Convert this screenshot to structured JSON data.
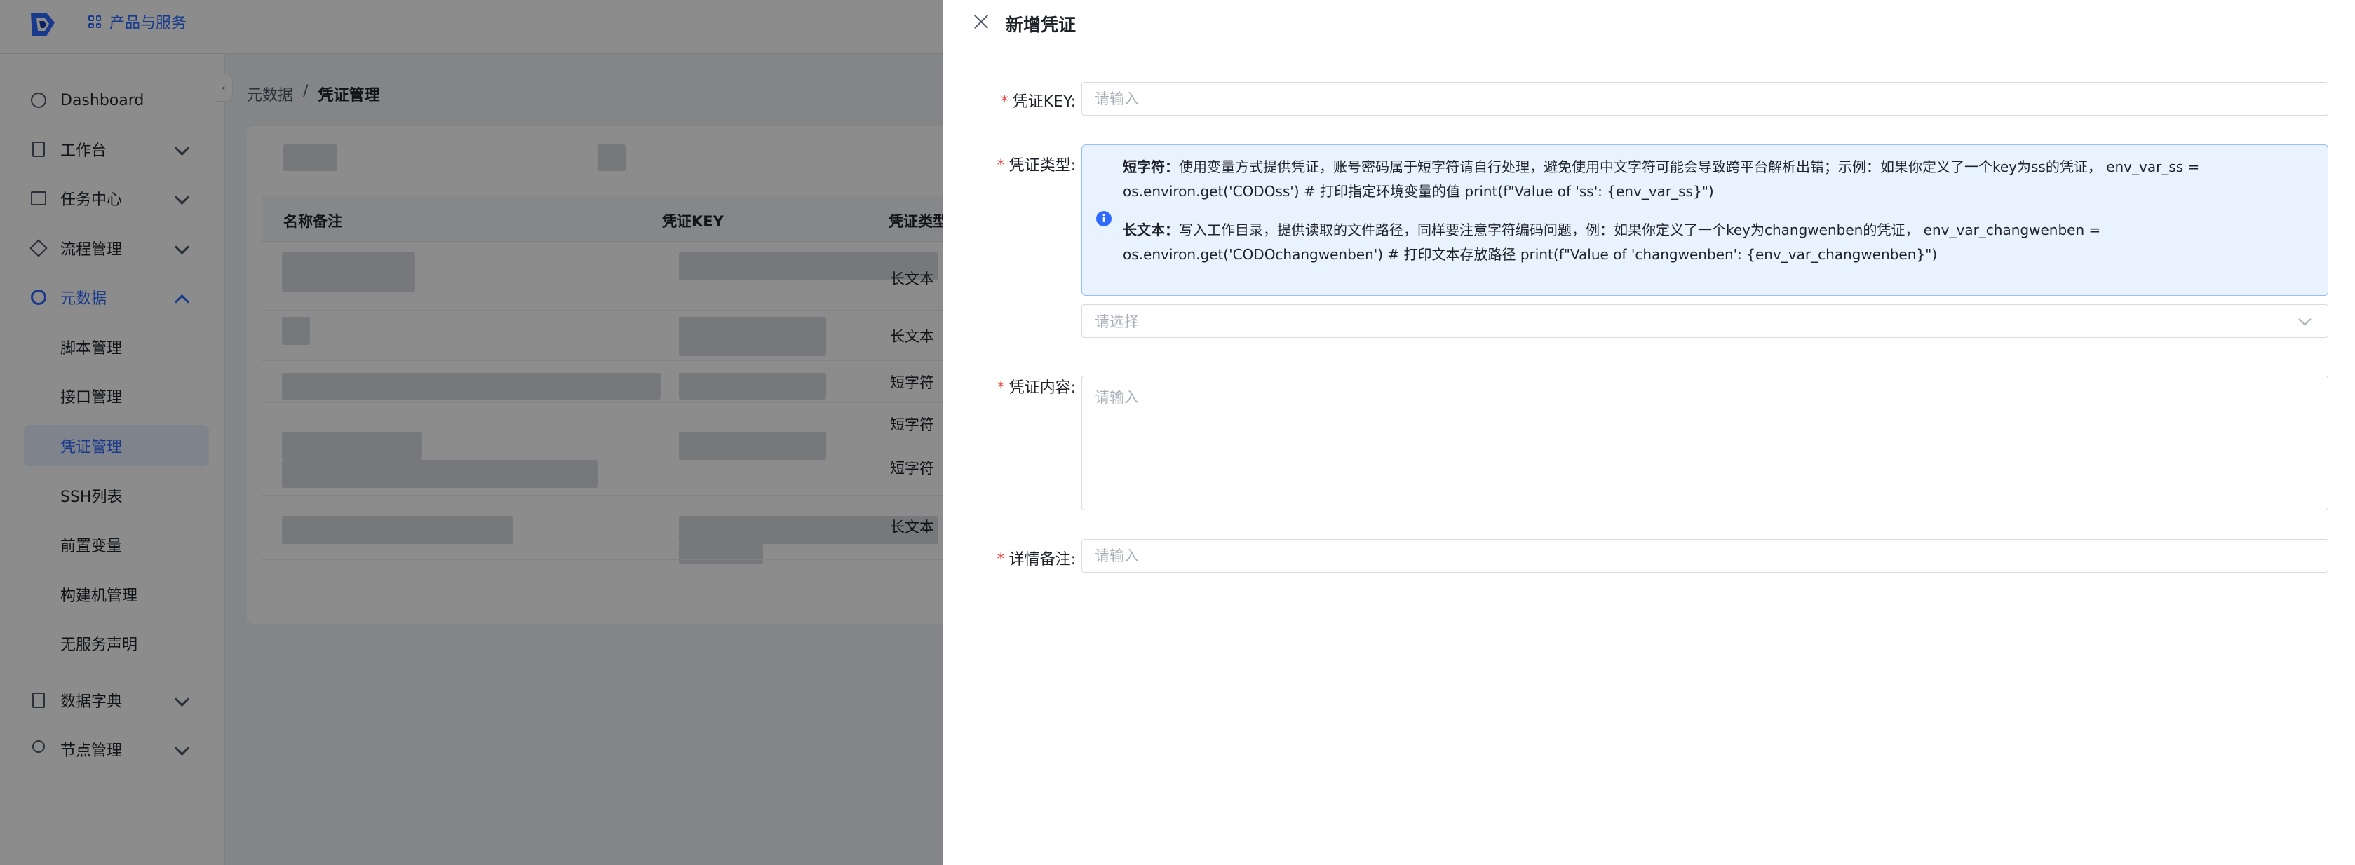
{
  "topbar": {
    "products_label": "产品与服务"
  },
  "sidebar": {
    "items": [
      {
        "label": "Dashboard",
        "icon": "dashboard-icon"
      },
      {
        "label": "工作台",
        "icon": "workbench-icon"
      },
      {
        "label": "任务中心",
        "icon": "task-icon"
      },
      {
        "label": "流程管理",
        "icon": "flow-icon"
      },
      {
        "label": "元数据",
        "icon": "metadata-icon"
      }
    ],
    "sub_items": [
      "脚本管理",
      "接口管理",
      "凭证管理",
      "SSH列表",
      "前置变量",
      "构建机管理",
      "无服务声明"
    ],
    "bottom_items": [
      {
        "label": "数据字典",
        "icon": "dictionary-icon"
      },
      {
        "label": "节点管理",
        "icon": "node-icon"
      }
    ]
  },
  "breadcrumb": {
    "parent": "元数据",
    "separator": "/",
    "current": "凭证管理"
  },
  "table": {
    "columns": [
      "名称备注",
      "凭证KEY",
      "凭证类型"
    ],
    "types": [
      "长文本",
      "长文本",
      "短字符",
      "短字符",
      "短字符",
      "长文本"
    ]
  },
  "drawer": {
    "title": "新增凭证",
    "key": {
      "label": "凭证KEY:",
      "placeholder": "请输入"
    },
    "type": {
      "label": "凭证类型:",
      "alert_line1_bold": "短字符：",
      "alert_line1": "使用变量方式提供凭证，账号密码属于短字符请自行处理，避免使用中文字符可能会导致跨平台解析出错；示例：如果你定义了一个key为ss的凭证， env_var_ss = os.environ.get('CODOss') # 打印指定环境变量的值 print(f\"Value of 'ss': {env_var_ss}\")",
      "alert_line2_bold": "长文本：",
      "alert_line2": "写入工作目录，提供读取的文件路径，同样要注意字符编码问题，例：如果你定义了一个key为changwenben的凭证， env_var_changwenben = os.environ.get('CODOchangwenben') # 打印文本存放路径 print(f\"Value of 'changwenben': {env_var_changwenben}\")",
      "select_placeholder": "请选择"
    },
    "content": {
      "label": "凭证内容:",
      "placeholder": "请输入"
    },
    "remark": {
      "label": "详情备注:",
      "placeholder": "请输入"
    }
  },
  "colors": {
    "primary": "#2f6bff",
    "required": "#f53f3f",
    "alert_bg": "#e8f3ff"
  }
}
